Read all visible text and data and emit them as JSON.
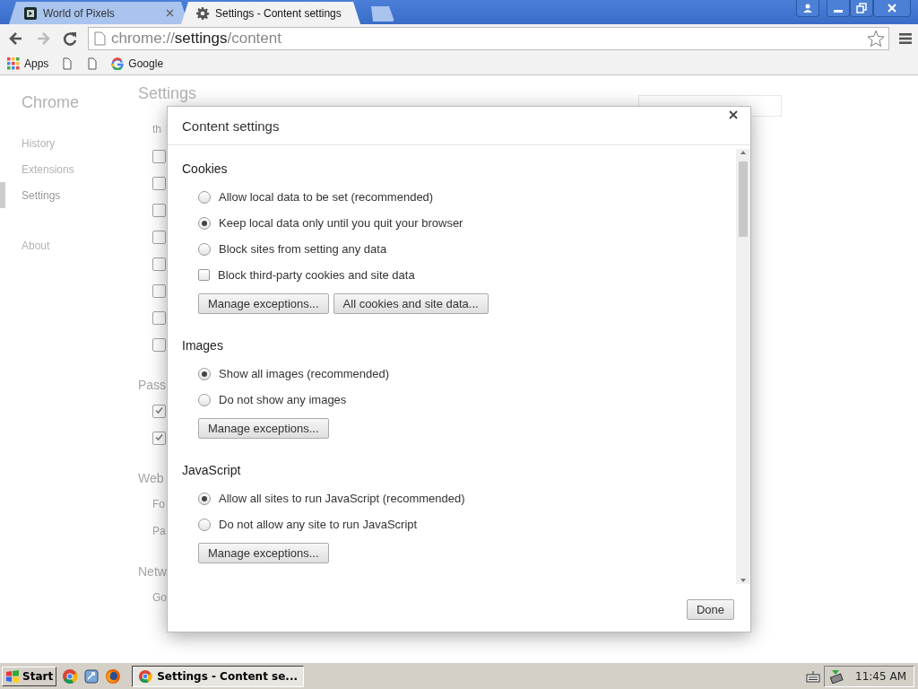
{
  "tabs": [
    {
      "title": "World of Pixels",
      "kind": "pixels",
      "selected": false
    },
    {
      "title": "Settings - Content settings",
      "kind": "gear",
      "selected": true
    }
  ],
  "address": {
    "scheme": "chrome://",
    "host": "settings",
    "path": "/content"
  },
  "bookmarks": [
    {
      "kind": "apps",
      "label": "Apps"
    },
    {
      "kind": "page"
    },
    {
      "kind": "page"
    },
    {
      "kind": "google",
      "label": "Google"
    }
  ],
  "background": {
    "sidebar_title": "Chrome",
    "sidebar_items": [
      {
        "label": "History",
        "selected": false
      },
      {
        "label": "Extensions",
        "selected": false
      },
      {
        "label": "Settings",
        "selected": true
      },
      {
        "label": "About",
        "selected": false
      }
    ],
    "heading": "Settings",
    "content": [
      {
        "kind": "text",
        "text": "th"
      },
      {
        "kind": "checkbox",
        "checked": false
      },
      {
        "kind": "checkbox",
        "checked": false
      },
      {
        "kind": "checkbox",
        "checked": false
      },
      {
        "kind": "checkbox",
        "checked": false
      },
      {
        "kind": "checkbox",
        "checked": false
      },
      {
        "kind": "checkbox",
        "checked": false
      },
      {
        "kind": "checkbox",
        "checked": false
      },
      {
        "kind": "checkbox",
        "checked": false
      },
      {
        "kind": "heading",
        "text": "Pass"
      },
      {
        "kind": "checkbox",
        "checked": true
      },
      {
        "kind": "checkbox",
        "checked": true
      },
      {
        "kind": "heading",
        "text": "Web"
      },
      {
        "kind": "text",
        "text": "Fo"
      },
      {
        "kind": "text",
        "text": "Pa"
      },
      {
        "kind": "heading",
        "text": "Netw"
      },
      {
        "kind": "text",
        "text": "Go"
      }
    ]
  },
  "dialog": {
    "title": "Content settings",
    "sections": [
      {
        "heading": "Cookies",
        "options": [
          {
            "kind": "radio",
            "label": "Allow local data to be set (recommended)",
            "selected": false
          },
          {
            "kind": "radio",
            "label": "Keep local data only until you quit your browser",
            "selected": true
          },
          {
            "kind": "radio",
            "label": "Block sites from setting any data",
            "selected": false
          },
          {
            "kind": "checkbox",
            "label": "Block third-party cookies and site data",
            "checked": false
          }
        ],
        "buttons": [
          "Manage exceptions...",
          "All cookies and site data..."
        ]
      },
      {
        "heading": "Images",
        "options": [
          {
            "kind": "radio",
            "label": "Show all images (recommended)",
            "selected": true
          },
          {
            "kind": "radio",
            "label": "Do not show any images",
            "selected": false
          }
        ],
        "buttons": [
          "Manage exceptions..."
        ]
      },
      {
        "heading": "JavaScript",
        "options": [
          {
            "kind": "radio",
            "label": "Allow all sites to run JavaScript (recommended)",
            "selected": true
          },
          {
            "kind": "radio",
            "label": "Do not allow any site to run JavaScript",
            "selected": false
          }
        ],
        "buttons": [
          "Manage exceptions..."
        ]
      }
    ],
    "done": "Done"
  },
  "taskbar": {
    "start": "Start",
    "window": "Settings - Content se...",
    "clock": "11:45 AM"
  }
}
